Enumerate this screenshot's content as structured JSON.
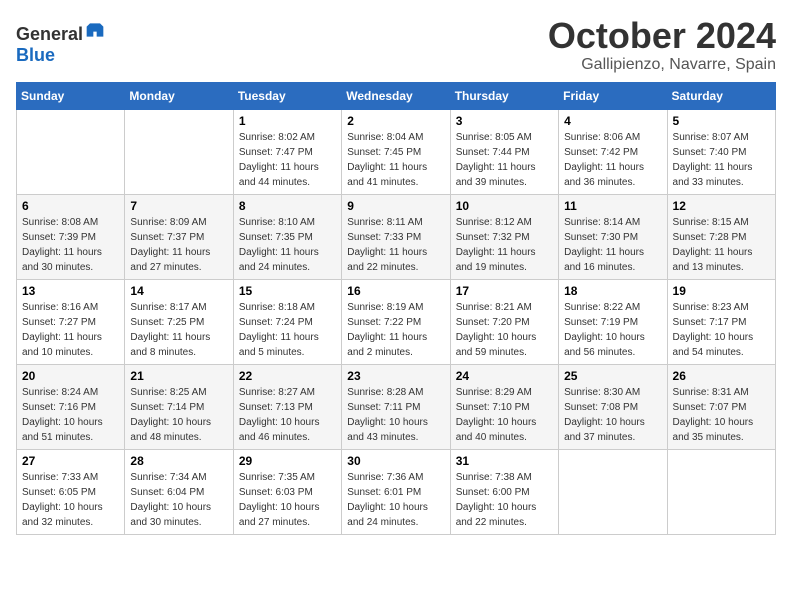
{
  "logo": {
    "general": "General",
    "blue": "Blue"
  },
  "title": "October 2024",
  "location": "Gallipienzo, Navarre, Spain",
  "weekdays": [
    "Sunday",
    "Monday",
    "Tuesday",
    "Wednesday",
    "Thursday",
    "Friday",
    "Saturday"
  ],
  "weeks": [
    [
      {
        "day": "",
        "info": ""
      },
      {
        "day": "",
        "info": ""
      },
      {
        "day": "1",
        "info": "Sunrise: 8:02 AM\nSunset: 7:47 PM\nDaylight: 11 hours\nand 44 minutes."
      },
      {
        "day": "2",
        "info": "Sunrise: 8:04 AM\nSunset: 7:45 PM\nDaylight: 11 hours\nand 41 minutes."
      },
      {
        "day": "3",
        "info": "Sunrise: 8:05 AM\nSunset: 7:44 PM\nDaylight: 11 hours\nand 39 minutes."
      },
      {
        "day": "4",
        "info": "Sunrise: 8:06 AM\nSunset: 7:42 PM\nDaylight: 11 hours\nand 36 minutes."
      },
      {
        "day": "5",
        "info": "Sunrise: 8:07 AM\nSunset: 7:40 PM\nDaylight: 11 hours\nand 33 minutes."
      }
    ],
    [
      {
        "day": "6",
        "info": "Sunrise: 8:08 AM\nSunset: 7:39 PM\nDaylight: 11 hours\nand 30 minutes."
      },
      {
        "day": "7",
        "info": "Sunrise: 8:09 AM\nSunset: 7:37 PM\nDaylight: 11 hours\nand 27 minutes."
      },
      {
        "day": "8",
        "info": "Sunrise: 8:10 AM\nSunset: 7:35 PM\nDaylight: 11 hours\nand 24 minutes."
      },
      {
        "day": "9",
        "info": "Sunrise: 8:11 AM\nSunset: 7:33 PM\nDaylight: 11 hours\nand 22 minutes."
      },
      {
        "day": "10",
        "info": "Sunrise: 8:12 AM\nSunset: 7:32 PM\nDaylight: 11 hours\nand 19 minutes."
      },
      {
        "day": "11",
        "info": "Sunrise: 8:14 AM\nSunset: 7:30 PM\nDaylight: 11 hours\nand 16 minutes."
      },
      {
        "day": "12",
        "info": "Sunrise: 8:15 AM\nSunset: 7:28 PM\nDaylight: 11 hours\nand 13 minutes."
      }
    ],
    [
      {
        "day": "13",
        "info": "Sunrise: 8:16 AM\nSunset: 7:27 PM\nDaylight: 11 hours\nand 10 minutes."
      },
      {
        "day": "14",
        "info": "Sunrise: 8:17 AM\nSunset: 7:25 PM\nDaylight: 11 hours\nand 8 minutes."
      },
      {
        "day": "15",
        "info": "Sunrise: 8:18 AM\nSunset: 7:24 PM\nDaylight: 11 hours\nand 5 minutes."
      },
      {
        "day": "16",
        "info": "Sunrise: 8:19 AM\nSunset: 7:22 PM\nDaylight: 11 hours\nand 2 minutes."
      },
      {
        "day": "17",
        "info": "Sunrise: 8:21 AM\nSunset: 7:20 PM\nDaylight: 10 hours\nand 59 minutes."
      },
      {
        "day": "18",
        "info": "Sunrise: 8:22 AM\nSunset: 7:19 PM\nDaylight: 10 hours\nand 56 minutes."
      },
      {
        "day": "19",
        "info": "Sunrise: 8:23 AM\nSunset: 7:17 PM\nDaylight: 10 hours\nand 54 minutes."
      }
    ],
    [
      {
        "day": "20",
        "info": "Sunrise: 8:24 AM\nSunset: 7:16 PM\nDaylight: 10 hours\nand 51 minutes."
      },
      {
        "day": "21",
        "info": "Sunrise: 8:25 AM\nSunset: 7:14 PM\nDaylight: 10 hours\nand 48 minutes."
      },
      {
        "day": "22",
        "info": "Sunrise: 8:27 AM\nSunset: 7:13 PM\nDaylight: 10 hours\nand 46 minutes."
      },
      {
        "day": "23",
        "info": "Sunrise: 8:28 AM\nSunset: 7:11 PM\nDaylight: 10 hours\nand 43 minutes."
      },
      {
        "day": "24",
        "info": "Sunrise: 8:29 AM\nSunset: 7:10 PM\nDaylight: 10 hours\nand 40 minutes."
      },
      {
        "day": "25",
        "info": "Sunrise: 8:30 AM\nSunset: 7:08 PM\nDaylight: 10 hours\nand 37 minutes."
      },
      {
        "day": "26",
        "info": "Sunrise: 8:31 AM\nSunset: 7:07 PM\nDaylight: 10 hours\nand 35 minutes."
      }
    ],
    [
      {
        "day": "27",
        "info": "Sunrise: 7:33 AM\nSunset: 6:05 PM\nDaylight: 10 hours\nand 32 minutes."
      },
      {
        "day": "28",
        "info": "Sunrise: 7:34 AM\nSunset: 6:04 PM\nDaylight: 10 hours\nand 30 minutes."
      },
      {
        "day": "29",
        "info": "Sunrise: 7:35 AM\nSunset: 6:03 PM\nDaylight: 10 hours\nand 27 minutes."
      },
      {
        "day": "30",
        "info": "Sunrise: 7:36 AM\nSunset: 6:01 PM\nDaylight: 10 hours\nand 24 minutes."
      },
      {
        "day": "31",
        "info": "Sunrise: 7:38 AM\nSunset: 6:00 PM\nDaylight: 10 hours\nand 22 minutes."
      },
      {
        "day": "",
        "info": ""
      },
      {
        "day": "",
        "info": ""
      }
    ]
  ]
}
